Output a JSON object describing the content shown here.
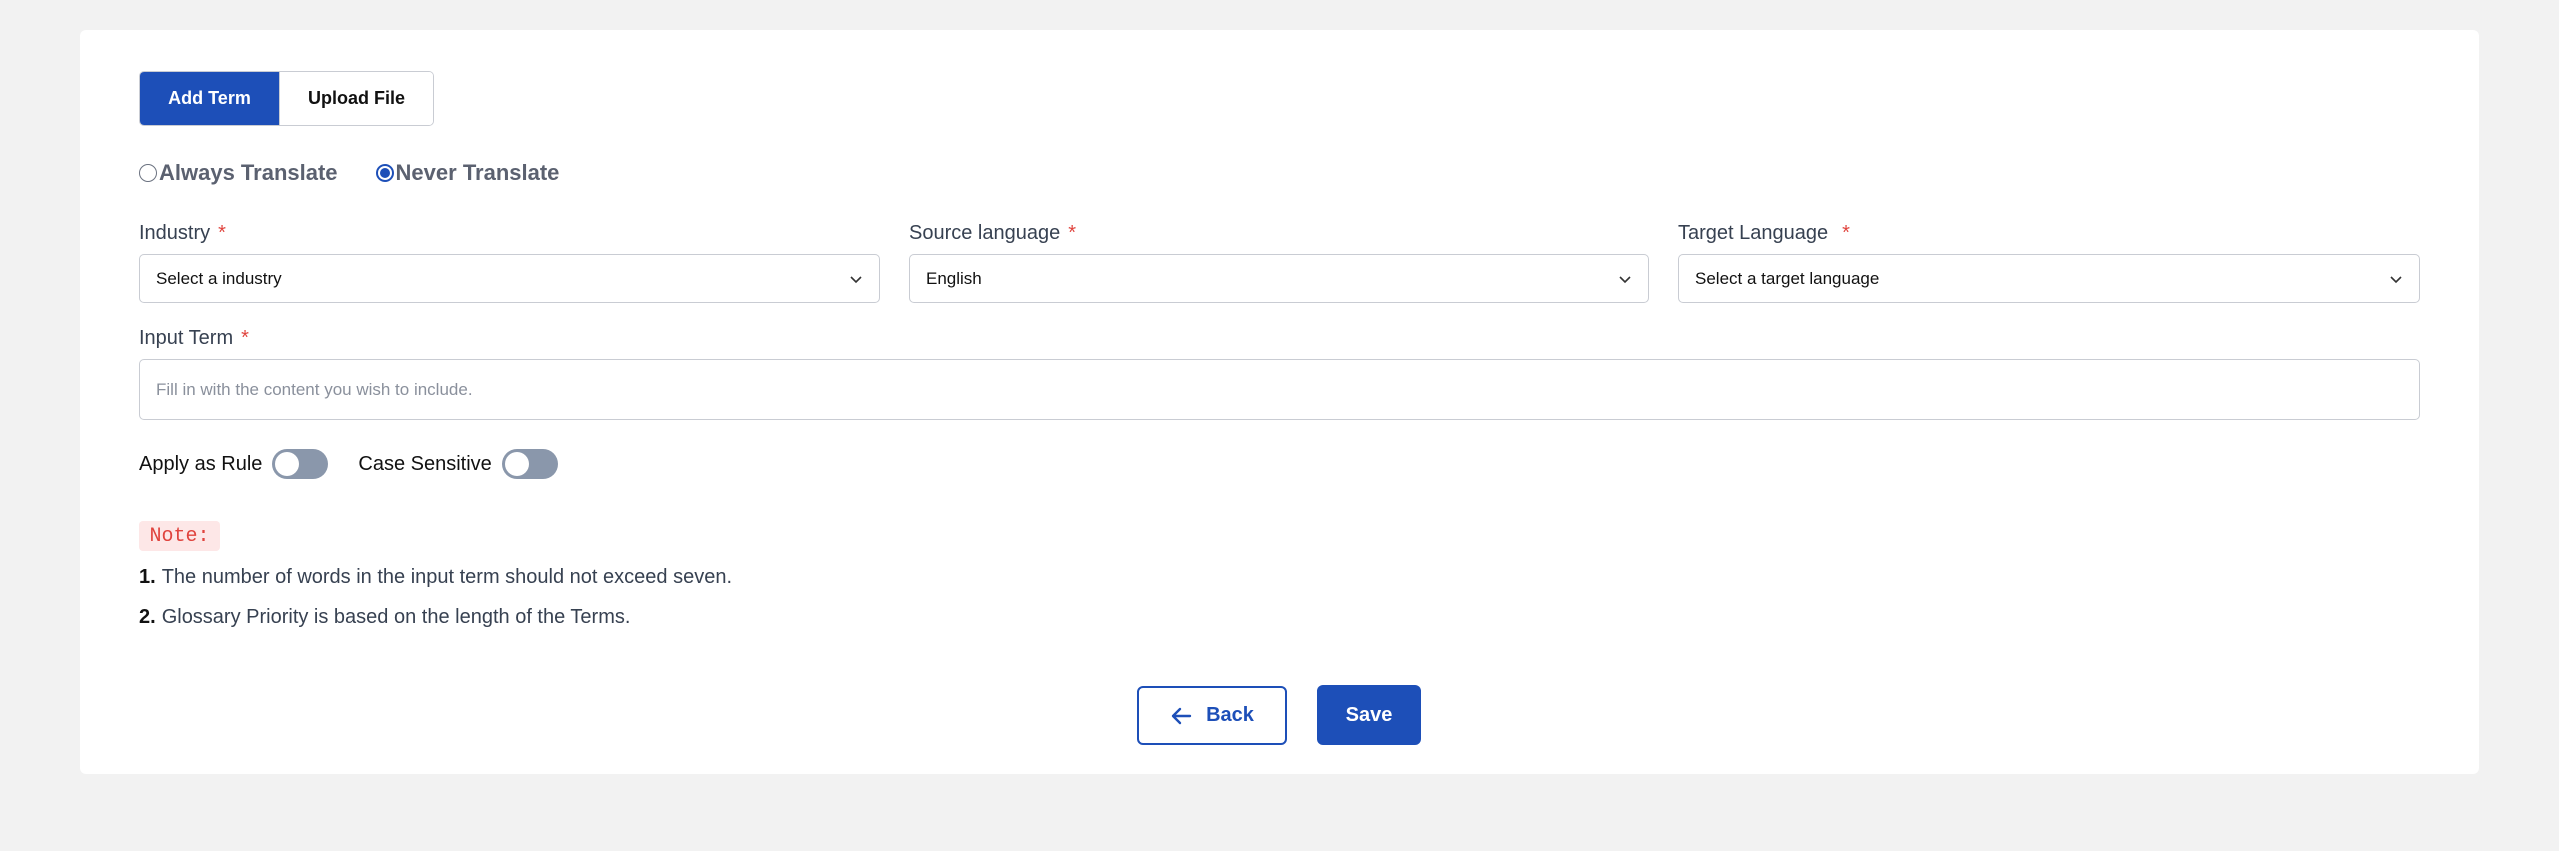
{
  "tabs": {
    "add_term": "Add Term",
    "upload_file": "Upload File"
  },
  "radios": {
    "always": "Always Translate",
    "never": "Never Translate",
    "selected": "Never Translate"
  },
  "fields": {
    "industry": {
      "label": "Industry",
      "required": "*",
      "value": "Select a industry"
    },
    "source": {
      "label": "Source language",
      "required": "*",
      "value": "English"
    },
    "target": {
      "label": "Target Language",
      "required": "*",
      "value": "Select a target language"
    },
    "input_term": {
      "label": "Input Term",
      "required": "*",
      "placeholder": "Fill in with the content you wish to include."
    }
  },
  "toggles": {
    "apply_rule": "Apply as Rule",
    "apply_rule_on": false,
    "case_sensitive": "Case Sensitive",
    "case_sensitive_on": false
  },
  "note": {
    "title": "Note:",
    "items": [
      {
        "num": "1.",
        "text": "The number of words in the input term should not exceed seven."
      },
      {
        "num": "2.",
        "text": "Glossary Priority is based on the length of the Terms."
      }
    ]
  },
  "actions": {
    "back": "Back",
    "save": "Save"
  },
  "colors": {
    "primary": "#1d4fb8",
    "required": "#e0443e",
    "toggle_off": "#8a97ab"
  }
}
